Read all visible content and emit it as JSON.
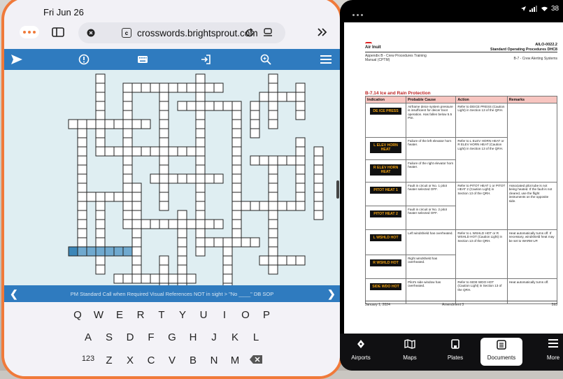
{
  "left_app": {
    "status_date": "Fri Jun 26",
    "browser": {
      "url": "crosswords.brightsprout.com"
    },
    "toolbar_icons": [
      "send-icon",
      "alert-icon",
      "keyboard-icon",
      "exit-icon",
      "zoom-icon",
      "menu-icon"
    ],
    "clue_text": "PM Standard Call when Required Visual References NOT in sight > \"No ____\" DB SOP",
    "keyboard": {
      "row1": [
        "Q",
        "W",
        "E",
        "R",
        "T",
        "Y",
        "U",
        "I",
        "O",
        "P"
      ],
      "row2": [
        "A",
        "S",
        "D",
        "F",
        "G",
        "H",
        "J",
        "K",
        "L"
      ],
      "row3": [
        "123",
        "Z",
        "X",
        "C",
        "V",
        "B",
        "N",
        "M"
      ]
    },
    "colors": {
      "accent": "#2f7bbf",
      "grid_bg": "#dfeef2",
      "highlight": "#6fa9cf",
      "active": "#3b86b8",
      "border": "#f07a3a"
    }
  },
  "right_app": {
    "status_signal": "38",
    "doc": {
      "logo": "Air Inuit",
      "doc_id": "AILO-0022.2",
      "doc_title": "Standard Operating Procedures DHC8",
      "appendix": "Appendix B - Crew Procedures Training Manual (CPTM)",
      "section_ref": "B-7 - Crew Alerting Systems",
      "section_title": "B-7.14    Ice and Rain Protection",
      "headers": [
        "Indication",
        "Probable Cause",
        "Action",
        "Remarks"
      ],
      "rows": [
        {
          "indication": "DE ICE PRESS",
          "cause": "Airframe deice system pressure is insufficient for deicer boot operation. Has fallen below 5.5 PSI.",
          "action": "Refer to DEICE PRESS (Caution Light) in Section 13 of the QRH.",
          "remarks": ""
        },
        {
          "indication": "L ELEV HORN HEAT",
          "cause": "Failure of the left elevator horn heater.",
          "action": "Refer to L ELEV HORN HEAT or R ELEV HORN HEAT (Caution Light) in Section 13 of the QRH.",
          "remarks": ""
        },
        {
          "indication": "R ELEV HORN HEAT",
          "cause": "Failure of the right elevator horn heater.",
          "action": "",
          "remarks": ""
        },
        {
          "indication": "PITOT HEAT 1",
          "cause": "Fault in circuit or No. 1 pitot heater selected OFF.",
          "action": "Refer to PITOT HEAT 1 or PITOT HEAT 2 (Caution Light) in Section 13 of the QRH.",
          "remarks": "Associated pilot tube is not being heated. If the fault is not cleared, use the flight instruments on the opposite side."
        },
        {
          "indication": "PITOT HEAT 2",
          "cause": "Fault in circuit or No. 2 pitot heater selected OFF.",
          "action": "",
          "remarks": ""
        },
        {
          "indication": "L WSHLD HOT",
          "cause": "Left windshield has overheated.",
          "action": "Refer to L WSHLD HOT or R WSHLD HOT (Caution Light) in Section 13 of the QRH.",
          "remarks": "Heat automatically turns off. If necessary, windshield heat may be set to WARM UP."
        },
        {
          "indication": "R WSHLD HOT",
          "cause": "Right windshield has overheated.",
          "action": "",
          "remarks": ""
        },
        {
          "indication": "SIDE WDO HOT",
          "cause": "Pilot's side window has overheated.",
          "action": "Refer to SIDE WDO HOT (Caution Light) in Section 13 of the QRH.",
          "remarks": "Heat automatically turns off."
        }
      ],
      "footer_date": "January 1, 2024",
      "footer_amendment": "Amendment 3",
      "footer_page": "593"
    },
    "tabs": [
      {
        "label": "Airports",
        "icon": "compass-icon"
      },
      {
        "label": "Maps",
        "icon": "map-icon"
      },
      {
        "label": "Plates",
        "icon": "plates-icon"
      },
      {
        "label": "Documents",
        "icon": "documents-icon",
        "active": true
      },
      {
        "label": "More",
        "icon": "menu-icon"
      }
    ]
  }
}
